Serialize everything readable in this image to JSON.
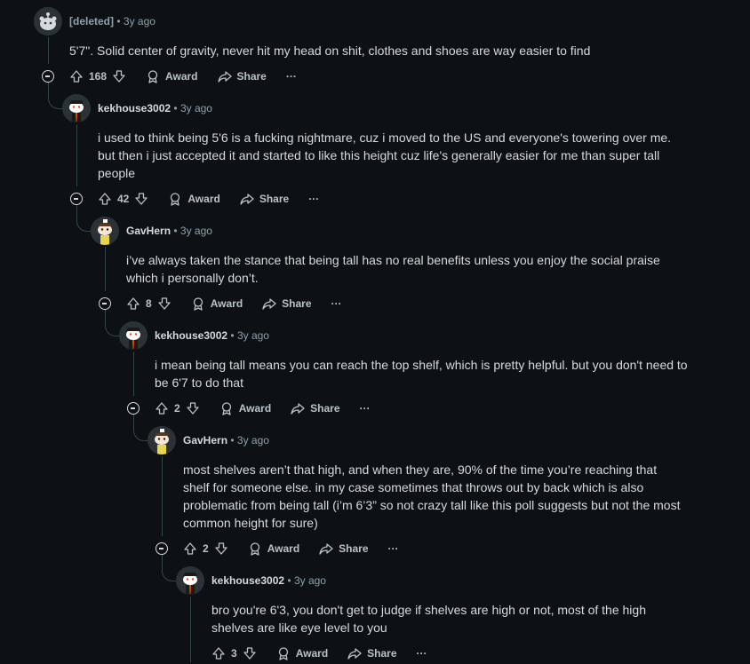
{
  "comments": [
    {
      "author": "[deleted]",
      "time": "3y ago",
      "body": "5'7\". Solid center of gravity, never hit my head on shit, clothes and shoes are way easier to find",
      "votes": "168",
      "award": "Award",
      "share": "Share",
      "more": "···"
    },
    {
      "author": "kekhouse3002",
      "time": "3y ago",
      "body": "i used to think being 5'6 is a fucking nightmare, cuz i moved to the US and everyone's towering over me. but then i just accepted it and started to like this height cuz life's generally easier for me than super tall people",
      "votes": "42",
      "award": "Award",
      "share": "Share",
      "more": "···"
    },
    {
      "author": "GavHern",
      "time": "3y ago",
      "body": "i’ve always taken the stance that being tall has no real benefits unless you enjoy the social praise which i personally don’t.",
      "votes": "8",
      "award": "Award",
      "share": "Share",
      "more": "···"
    },
    {
      "author": "kekhouse3002",
      "time": "3y ago",
      "body": "i mean being tall means you can reach the top shelf, which is pretty helpful. but you don't need to be 6'7 to do that",
      "votes": "2",
      "award": "Award",
      "share": "Share",
      "more": "···"
    },
    {
      "author": "GavHern",
      "time": "3y ago",
      "body": "most shelves aren’t that high, and when they are, 90% of the time you’re reaching that shelf for someone else. in my case sometimes that throws out by back which is also problematic from being tall (i’m 6’3” so not crazy tall like this poll suggests but not the most common height for sure)",
      "votes": "2",
      "award": "Award",
      "share": "Share",
      "more": "···"
    },
    {
      "author": "kekhouse3002",
      "time": "3y ago",
      "body": "bro you're 6'3, you don't get to judge if shelves are high or not, most of the high shelves are like eye level to you",
      "votes": "3",
      "award": "Award",
      "share": "Share",
      "more": "···"
    }
  ],
  "separator": "•",
  "colors": {
    "background": "#0e1113",
    "text": "#d7dadc",
    "meta": "#8ba2ad",
    "thread_line": "#33464c"
  },
  "icons": {
    "upvote": "upvote-arrow-icon",
    "downvote": "downvote-arrow-icon",
    "award": "award-icon",
    "share": "share-arrow-icon",
    "collapse": "collapse-minus-icon"
  }
}
